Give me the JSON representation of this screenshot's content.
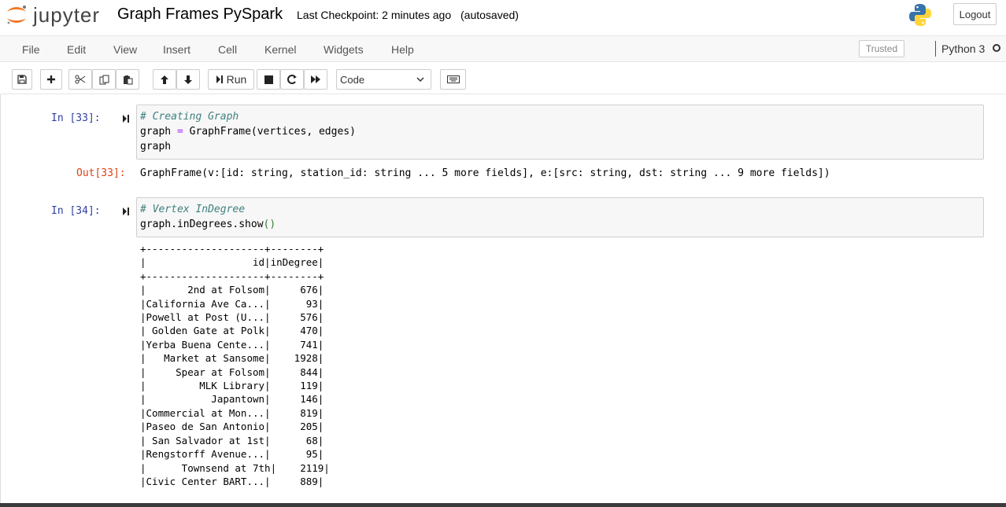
{
  "header": {
    "logo_text": "jupyter",
    "notebook_title": "Graph Frames PySpark",
    "checkpoint": "Last Checkpoint: 2 minutes ago",
    "autosave": "(autosaved)",
    "logout_label": "Logout"
  },
  "menubar": {
    "items": [
      "File",
      "Edit",
      "View",
      "Insert",
      "Cell",
      "Kernel",
      "Widgets",
      "Help"
    ],
    "trusted_label": "Trusted",
    "kernel_name": "Python 3"
  },
  "toolbar": {
    "run_label": "Run",
    "cell_type": "Code",
    "icons": [
      "save-icon",
      "add-cell-icon",
      "cut-icon",
      "copy-icon",
      "paste-icon",
      "move-up-icon",
      "move-down-icon",
      "run-icon",
      "stop-icon",
      "restart-icon",
      "fast-forward-icon",
      "keyboard-icon"
    ]
  },
  "cells": [
    {
      "prompt": "In [33]:",
      "code": {
        "comment": "# Creating Graph",
        "line2_var": "graph ",
        "line2_op": "=",
        "line2_rest": " GraphFrame(vertices, edges)",
        "line3": "graph"
      },
      "out_prompt": "Out[33]:",
      "output": "GraphFrame(v:[id: string, station_id: string ... 5 more fields], e:[src: string, dst: string ... 9 more fields])"
    },
    {
      "prompt": "In [34]:",
      "code": {
        "comment": "# Vertex InDegree",
        "line2": "graph.inDegrees.show",
        "line2_parens": "()"
      },
      "output_table": "+--------------------+--------+\n|                  id|inDegree|\n+--------------------+--------+\n|       2nd at Folsom|     676|\n|California Ave Ca...|      93|\n|Powell at Post (U...|     576|\n| Golden Gate at Polk|     470|\n|Yerba Buena Cente...|     741|\n|   Market at Sansome|    1928|\n|     Spear at Folsom|     844|\n|         MLK Library|     119|\n|           Japantown|     146|\n|Commercial at Mon...|     819|\n|Paseo de San Antonio|     205|\n| San Salvador at 1st|      68|\n|Rengstorff Avenue...|      95|\n|      Townsend at 7th|    2119|\n|Civic Center BART...|     889|"
    }
  ]
}
